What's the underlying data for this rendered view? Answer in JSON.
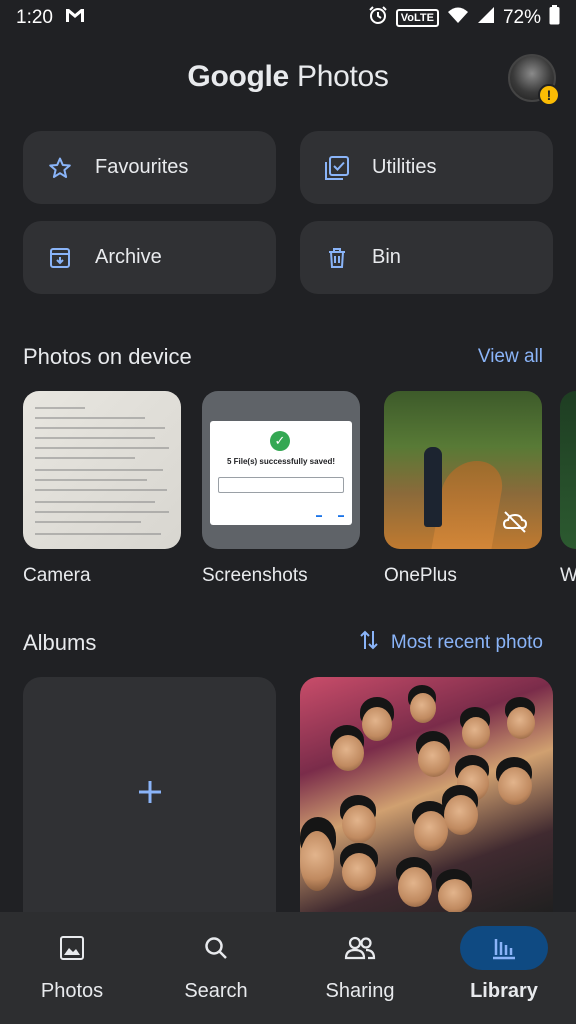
{
  "status_bar": {
    "time": "1:20",
    "mail_icon": "gmail-icon",
    "volte": "VoLTE",
    "battery": "72%"
  },
  "app_bar": {
    "title_brand": "Google",
    "title_product": "Photos",
    "account_warning_badge": "!"
  },
  "utilities": [
    {
      "label": "Favourites",
      "icon": "star-icon"
    },
    {
      "label": "Utilities",
      "icon": "checklist-icon"
    },
    {
      "label": "Archive",
      "icon": "archive-icon"
    },
    {
      "label": "Bin",
      "icon": "trash-icon"
    }
  ],
  "photos_on_device": {
    "title": "Photos on device",
    "view_all": "View all",
    "folders": [
      {
        "label": "Camera"
      },
      {
        "label": "Screenshots",
        "dialog_message": "5 File(s) successfully saved!"
      },
      {
        "label": "OnePlus",
        "badge_icon": "cloud-off-icon"
      },
      {
        "label": "W"
      }
    ]
  },
  "albums": {
    "title": "Albums",
    "sort_label": "Most recent photo",
    "new_album_icon": "plus-icon"
  },
  "bottom_nav": {
    "active": "Library",
    "items": [
      {
        "label": "Photos",
        "icon": "photo-icon"
      },
      {
        "label": "Search",
        "icon": "search-icon"
      },
      {
        "label": "Sharing",
        "icon": "people-icon"
      },
      {
        "label": "Library",
        "icon": "library-icon"
      }
    ]
  },
  "colors": {
    "background": "#202124",
    "surface": "#303134",
    "accent": "#8ab4f8",
    "nav_active_pill": "#0f4a82",
    "warning": "#fbbc04"
  }
}
